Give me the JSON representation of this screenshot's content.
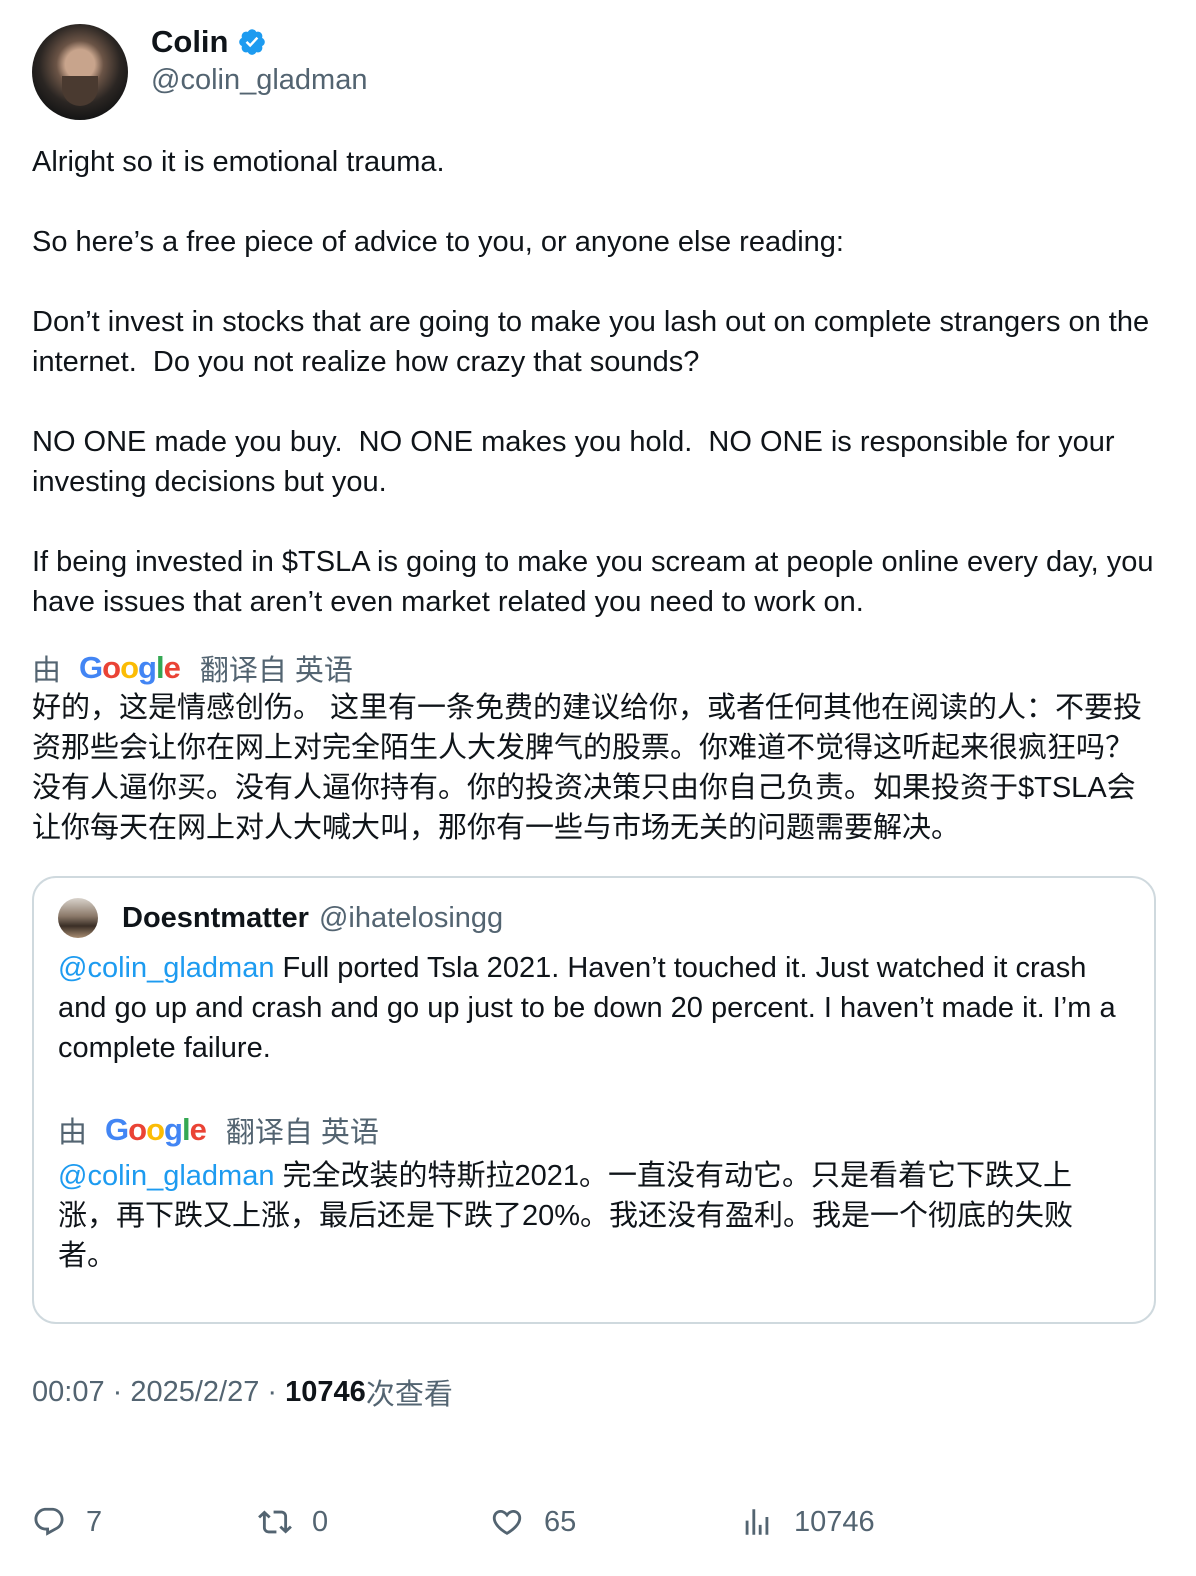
{
  "author": {
    "display_name": "Colin",
    "handle": "@colin_gladman"
  },
  "body": {
    "text": "Alright so it is emotional trauma.\n\nSo here’s a free piece of advice to you, or anyone else reading:\n\nDon’t invest in stocks that are going to make you lash out on complete strangers on the internet.  Do you not realize how crazy that sounds?\n\nNO ONE made you buy.  NO ONE makes you hold.  NO ONE is responsible for your investing decisions but you.\n\nIf being invested in $TSLA is going to make you scream at people online every day, you have issues that aren’t even market related you need to work on."
  },
  "translation": {
    "by_label": "由",
    "google_word": "Google",
    "from_label": "翻译自 英语",
    "text": "好的，这是情感创伤。 这里有一条免费的建议给你，或者任何其他在阅读的人：不要投资那些会让你在网上对完全陌生人大发脾气的股票。你难道不觉得这听起来很疯狂吗？ 没有人逼你买。没有人逼你持有。你的投资决策只由你自己负责。如果投资于$TSLA会让你每天在网上对人大喊大叫，那你有一些与市场无关的问题需要解决。"
  },
  "quote": {
    "display_name": "Doesntmatter",
    "handle": "@ihatelosingg",
    "mention": "@colin_gladman",
    "text": " Full ported Tsla 2021.  Haven’t touched it. Just watched it crash and go up and crash and go up just to be down 20 percent. I haven’t made it. I’m a complete failure.",
    "translation": {
      "by_label": "由",
      "google_word": "Google",
      "from_label": "翻译自 英语",
      "mention": "@colin_gladman",
      "text": " 完全改装的特斯拉2021。一直没有动它。只是看着它下跌又上涨，再下跌又上涨，最后还是下跌了20%。我还没有盈利。我是一个彻底的失败者。"
    }
  },
  "meta": {
    "time": "00:07",
    "separator": " · ",
    "date": "2025/2/27",
    "views_count": "10746",
    "views_label": "次查看"
  },
  "actions": {
    "replies": "7",
    "retweets": "0",
    "likes": "65",
    "views": "10746"
  },
  "colors": {
    "link": "#1d9bf0",
    "secondary_text": "#536471",
    "verified": "#1d9bf0"
  }
}
